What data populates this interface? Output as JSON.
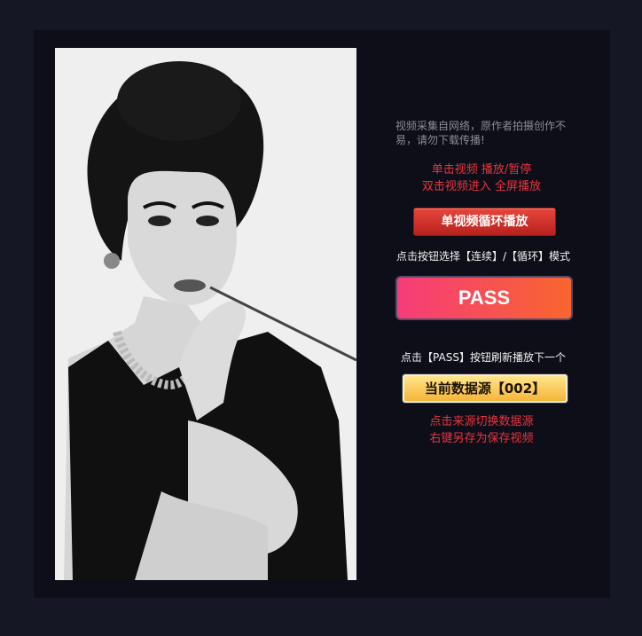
{
  "notice": "视频采集自网络，原作者拍摄创作不易，请勿下载传播!",
  "hints_top": [
    "单击视频 播放/暂停",
    "双击视频进入 全屏播放"
  ],
  "loop_button": "单视频循环播放",
  "mode_text": "点击按钮选择【连续】/【循环】模式",
  "pass_button": "PASS",
  "pass_hint": "点击【PASS】按钮刷新播放下一个",
  "source_button": "当前数据源【002】",
  "hints_bottom": [
    "点击来源切换数据源",
    "右键另存为保存视频"
  ],
  "colors": {
    "accent_red": "#e8353f",
    "pass_gradient_start": "#f53c7a",
    "pass_gradient_end": "#f9652e"
  }
}
